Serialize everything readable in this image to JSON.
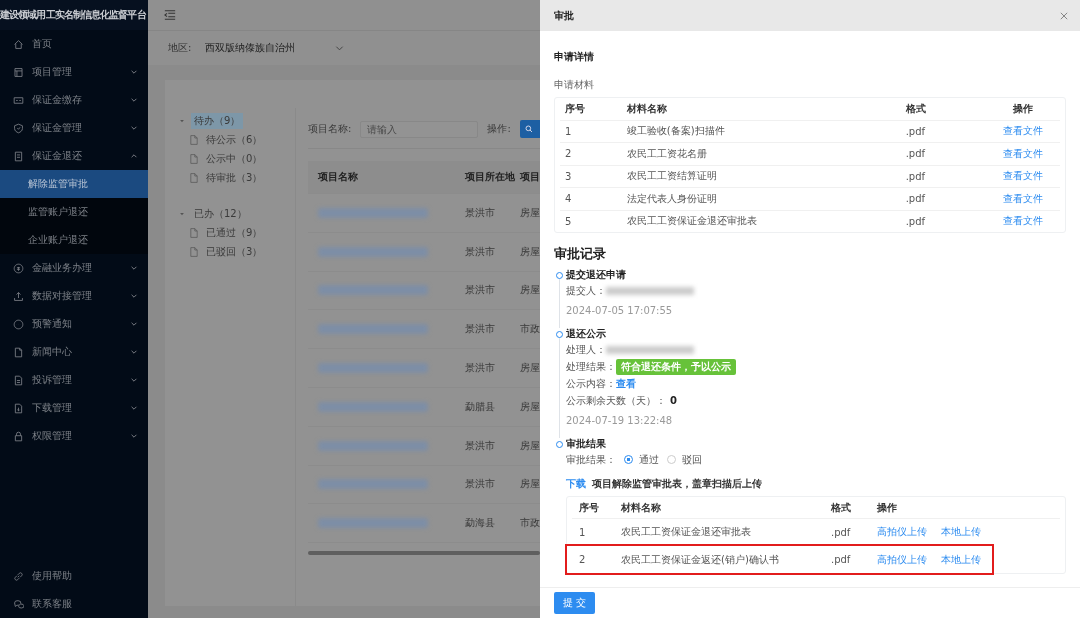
{
  "sidebar": {
    "title": "建设领域用工实名制信息化监督平台",
    "items": [
      {
        "label": "首页"
      },
      {
        "label": "项目管理",
        "expanded": false
      },
      {
        "label": "保证金缴存",
        "expanded": false
      },
      {
        "label": "保证金管理",
        "expanded": false
      },
      {
        "label": "保证金退还",
        "expanded": true,
        "children": [
          {
            "label": "解除监管审批",
            "selected": true
          },
          {
            "label": "监管账户退还",
            "selected": false
          },
          {
            "label": "企业账户退还",
            "selected": false
          }
        ]
      },
      {
        "label": "金融业务办理",
        "expanded": false
      },
      {
        "label": "数据对接管理",
        "expanded": false
      },
      {
        "label": "预警通知",
        "expanded": false
      },
      {
        "label": "新闻中心",
        "expanded": false
      },
      {
        "label": "投诉管理",
        "expanded": false
      },
      {
        "label": "下载管理",
        "expanded": false
      },
      {
        "label": "权限管理",
        "expanded": false
      }
    ],
    "footer_items": [
      {
        "label": "使用帮助"
      },
      {
        "label": "联系客服"
      }
    ]
  },
  "filter_bar": {
    "label": "地区:",
    "value": "西双版纳傣族自治州"
  },
  "tree": [
    {
      "label": "待办（9）",
      "selected": true,
      "children": [
        {
          "label": "待公示（6）",
          "selected": false
        },
        {
          "label": "公示中（0）",
          "selected": false
        },
        {
          "label": "待审批（3）",
          "selected": false
        }
      ]
    },
    {
      "label": "已办（12）",
      "selected": false,
      "children": [
        {
          "label": "已通过（9）",
          "selected": false
        },
        {
          "label": "已驳回（3）",
          "selected": false
        }
      ]
    }
  ],
  "search": {
    "label": "项目名称:",
    "placeholder": "请输入",
    "action_label": "操作:"
  },
  "table": {
    "columns": [
      "项目名称",
      "项目所在地",
      "项目"
    ],
    "rows": [
      [
        "",
        "景洪市",
        "房屋"
      ],
      [
        "",
        "景洪市",
        "房屋"
      ],
      [
        "",
        "景洪市",
        "房屋"
      ],
      [
        "",
        "景洪市",
        "市政"
      ],
      [
        "",
        "景洪市",
        "房屋"
      ],
      [
        "",
        "勐腊县",
        "房屋"
      ],
      [
        "",
        "景洪市",
        "房屋"
      ],
      [
        "",
        "景洪市",
        "房屋"
      ],
      [
        "",
        "勐海县",
        "市政"
      ]
    ]
  },
  "drawer": {
    "title": "审批",
    "section_title": "申请详情",
    "materials_title": "申请材料",
    "materials": {
      "columns": [
        "序号",
        "材料名称",
        "格式",
        "操作"
      ],
      "rows": [
        {
          "index": "1",
          "name": "竣工验收(备案)扫描件",
          "format": ".pdf",
          "action": "查看文件"
        },
        {
          "index": "2",
          "name": "农民工工资花名册",
          "format": ".pdf",
          "action": "查看文件"
        },
        {
          "index": "3",
          "name": "农民工工资结算证明",
          "format": ".pdf",
          "action": "查看文件"
        },
        {
          "index": "4",
          "name": "法定代表人身份证明",
          "format": ".pdf",
          "action": "查看文件"
        },
        {
          "index": "5",
          "name": "农民工工资保证金退还审批表",
          "format": ".pdf",
          "action": "查看文件"
        }
      ]
    },
    "records_title": "审批记录",
    "timeline": [
      {
        "title": "提交退还申请",
        "fields": [
          {
            "kind": "redacted",
            "label": "提交人："
          },
          {
            "kind": "time",
            "value": "2024-07-05 17:07:55"
          }
        ]
      },
      {
        "title": "退还公示",
        "fields": [
          {
            "kind": "redacted",
            "label": "处理人："
          },
          {
            "kind": "tag",
            "label": "处理结果：",
            "value": "符合退还条件，予以公示",
            "color": "#67c23a"
          },
          {
            "kind": "link",
            "label": "公示内容：",
            "value": "查看"
          },
          {
            "kind": "text",
            "label": "公示剩余天数（天）：",
            "value": "0"
          },
          {
            "kind": "time",
            "value": "2024-07-19 13:22:48"
          }
        ]
      },
      {
        "title": "审批结果",
        "fields": [
          {
            "kind": "radio",
            "label": "审批结果：",
            "options": [
              {
                "label": "通过",
                "selected": true
              },
              {
                "label": "驳回",
                "selected": false
              }
            ]
          }
        ]
      }
    ],
    "download_link": "下载",
    "download_note": "项目解除监管审批表，盖章扫描后上传",
    "uploads": {
      "columns": [
        "序号",
        "材料名称",
        "格式",
        "操作"
      ],
      "rows": [
        {
          "index": "1",
          "name": "农民工工资保证金退还审批表",
          "format": ".pdf",
          "actions": [
            "高拍仪上传",
            "本地上传"
          ],
          "highlighted": false
        },
        {
          "index": "2",
          "name": "农民工工资保证金返还(销户)确认书",
          "format": ".pdf",
          "actions": [
            "高拍仪上传",
            "本地上传"
          ],
          "highlighted": true
        }
      ]
    },
    "submit": "提 交"
  }
}
